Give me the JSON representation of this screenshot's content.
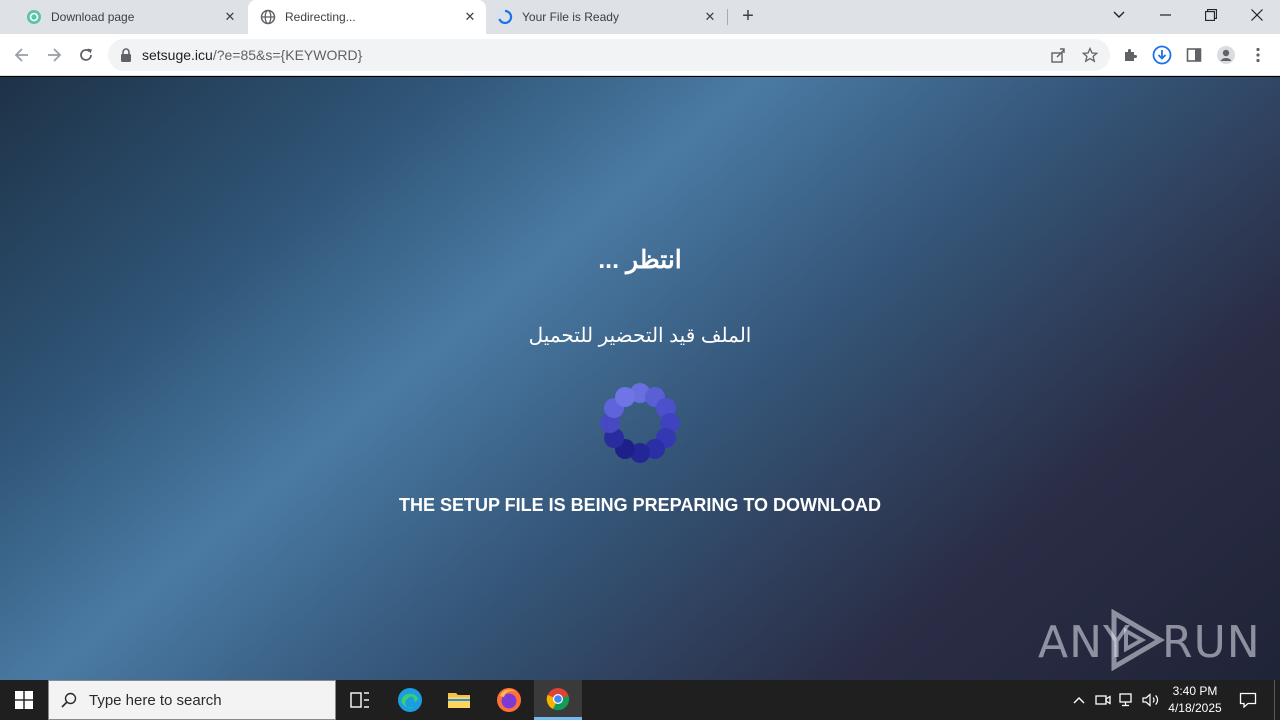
{
  "tabs": [
    {
      "title": "Download page",
      "favicon": "download-page-icon"
    },
    {
      "title": "Redirecting...",
      "favicon": "globe-icon"
    },
    {
      "title": "Your File is Ready",
      "favicon": "loading-spinner-icon"
    }
  ],
  "address_bar": {
    "host": "setsuge.icu",
    "path": "/?e=85&s={KEYWORD}"
  },
  "page": {
    "wait_text": "انتظر ...",
    "preparing_text": "الملف قيد التحضير للتحميل",
    "setup_text": "THE SETUP FILE IS BEING PREPARING TO DOWNLOAD"
  },
  "watermark": {
    "left": "ANY",
    "right": "RUN"
  },
  "taskbar": {
    "search_placeholder": "Type here to search",
    "time": "3:40 PM",
    "date": "4/18/2025"
  },
  "colors": {
    "spinner": "#3b3fb8",
    "accent": "#1a73e8"
  }
}
